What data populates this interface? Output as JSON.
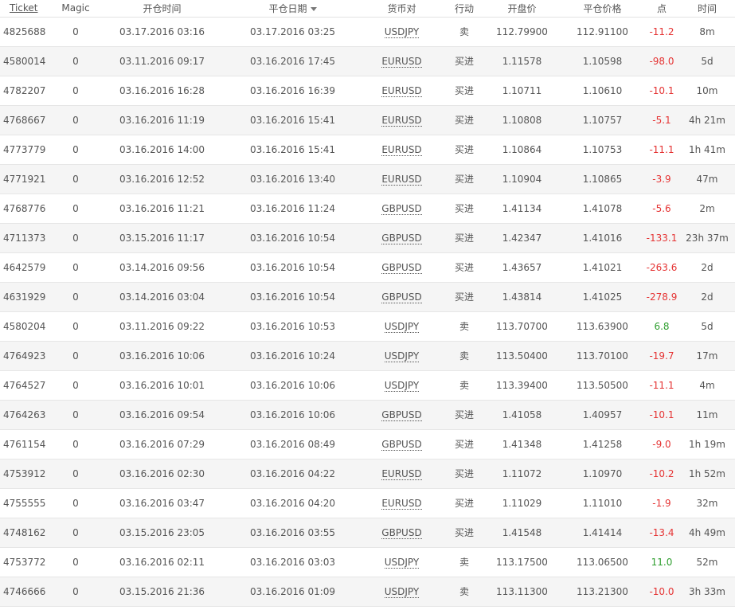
{
  "headers": {
    "ticket": "Ticket",
    "magic": "Magic",
    "open_time": "开仓时间",
    "close_date": "平仓日期",
    "symbol": "货币对",
    "action": "行动",
    "open_price": "开盘价",
    "close_price": "平仓价格",
    "points": "点",
    "duration": "时间"
  },
  "colors": {
    "negative": "#e53333",
    "positive": "#2e9e2e"
  },
  "rows": [
    {
      "ticket": "4825688",
      "magic": "0",
      "open": "03.17.2016 03:16",
      "close": "03.17.2016 03:25",
      "symbol": "USDJPY",
      "action": "卖",
      "open_price": "112.79900",
      "close_price": "112.91100",
      "points": "-11.2",
      "duration": "8m",
      "sign": "neg"
    },
    {
      "ticket": "4580014",
      "magic": "0",
      "open": "03.11.2016 09:17",
      "close": "03.16.2016 17:45",
      "symbol": "EURUSD",
      "action": "买进",
      "open_price": "1.11578",
      "close_price": "1.10598",
      "points": "-98.0",
      "duration": "5d",
      "sign": "neg"
    },
    {
      "ticket": "4782207",
      "magic": "0",
      "open": "03.16.2016 16:28",
      "close": "03.16.2016 16:39",
      "symbol": "EURUSD",
      "action": "买进",
      "open_price": "1.10711",
      "close_price": "1.10610",
      "points": "-10.1",
      "duration": "10m",
      "sign": "neg"
    },
    {
      "ticket": "4768667",
      "magic": "0",
      "open": "03.16.2016 11:19",
      "close": "03.16.2016 15:41",
      "symbol": "EURUSD",
      "action": "买进",
      "open_price": "1.10808",
      "close_price": "1.10757",
      "points": "-5.1",
      "duration": "4h 21m",
      "sign": "neg"
    },
    {
      "ticket": "4773779",
      "magic": "0",
      "open": "03.16.2016 14:00",
      "close": "03.16.2016 15:41",
      "symbol": "EURUSD",
      "action": "买进",
      "open_price": "1.10864",
      "close_price": "1.10753",
      "points": "-11.1",
      "duration": "1h 41m",
      "sign": "neg"
    },
    {
      "ticket": "4771921",
      "magic": "0",
      "open": "03.16.2016 12:52",
      "close": "03.16.2016 13:40",
      "symbol": "EURUSD",
      "action": "买进",
      "open_price": "1.10904",
      "close_price": "1.10865",
      "points": "-3.9",
      "duration": "47m",
      "sign": "neg"
    },
    {
      "ticket": "4768776",
      "magic": "0",
      "open": "03.16.2016 11:21",
      "close": "03.16.2016 11:24",
      "symbol": "GBPUSD",
      "action": "买进",
      "open_price": "1.41134",
      "close_price": "1.41078",
      "points": "-5.6",
      "duration": "2m",
      "sign": "neg"
    },
    {
      "ticket": "4711373",
      "magic": "0",
      "open": "03.15.2016 11:17",
      "close": "03.16.2016 10:54",
      "symbol": "GBPUSD",
      "action": "买进",
      "open_price": "1.42347",
      "close_price": "1.41016",
      "points": "-133.1",
      "duration": "23h 37m",
      "sign": "neg"
    },
    {
      "ticket": "4642579",
      "magic": "0",
      "open": "03.14.2016 09:56",
      "close": "03.16.2016 10:54",
      "symbol": "GBPUSD",
      "action": "买进",
      "open_price": "1.43657",
      "close_price": "1.41021",
      "points": "-263.6",
      "duration": "2d",
      "sign": "neg"
    },
    {
      "ticket": "4631929",
      "magic": "0",
      "open": "03.14.2016 03:04",
      "close": "03.16.2016 10:54",
      "symbol": "GBPUSD",
      "action": "买进",
      "open_price": "1.43814",
      "close_price": "1.41025",
      "points": "-278.9",
      "duration": "2d",
      "sign": "neg"
    },
    {
      "ticket": "4580204",
      "magic": "0",
      "open": "03.11.2016 09:22",
      "close": "03.16.2016 10:53",
      "symbol": "USDJPY",
      "action": "卖",
      "open_price": "113.70700",
      "close_price": "113.63900",
      "points": "6.8",
      "duration": "5d",
      "sign": "pos"
    },
    {
      "ticket": "4764923",
      "magic": "0",
      "open": "03.16.2016 10:06",
      "close": "03.16.2016 10:24",
      "symbol": "USDJPY",
      "action": "卖",
      "open_price": "113.50400",
      "close_price": "113.70100",
      "points": "-19.7",
      "duration": "17m",
      "sign": "neg"
    },
    {
      "ticket": "4764527",
      "magic": "0",
      "open": "03.16.2016 10:01",
      "close": "03.16.2016 10:06",
      "symbol": "USDJPY",
      "action": "卖",
      "open_price": "113.39400",
      "close_price": "113.50500",
      "points": "-11.1",
      "duration": "4m",
      "sign": "neg"
    },
    {
      "ticket": "4764263",
      "magic": "0",
      "open": "03.16.2016 09:54",
      "close": "03.16.2016 10:06",
      "symbol": "GBPUSD",
      "action": "买进",
      "open_price": "1.41058",
      "close_price": "1.40957",
      "points": "-10.1",
      "duration": "11m",
      "sign": "neg"
    },
    {
      "ticket": "4761154",
      "magic": "0",
      "open": "03.16.2016 07:29",
      "close": "03.16.2016 08:49",
      "symbol": "GBPUSD",
      "action": "买进",
      "open_price": "1.41348",
      "close_price": "1.41258",
      "points": "-9.0",
      "duration": "1h 19m",
      "sign": "neg"
    },
    {
      "ticket": "4753912",
      "magic": "0",
      "open": "03.16.2016 02:30",
      "close": "03.16.2016 04:22",
      "symbol": "EURUSD",
      "action": "买进",
      "open_price": "1.11072",
      "close_price": "1.10970",
      "points": "-10.2",
      "duration": "1h 52m",
      "sign": "neg"
    },
    {
      "ticket": "4755555",
      "magic": "0",
      "open": "03.16.2016 03:47",
      "close": "03.16.2016 04:20",
      "symbol": "EURUSD",
      "action": "买进",
      "open_price": "1.11029",
      "close_price": "1.11010",
      "points": "-1.9",
      "duration": "32m",
      "sign": "neg"
    },
    {
      "ticket": "4748162",
      "magic": "0",
      "open": "03.15.2016 23:05",
      "close": "03.16.2016 03:55",
      "symbol": "GBPUSD",
      "action": "买进",
      "open_price": "1.41548",
      "close_price": "1.41414",
      "points": "-13.4",
      "duration": "4h 49m",
      "sign": "neg"
    },
    {
      "ticket": "4753772",
      "magic": "0",
      "open": "03.16.2016 02:11",
      "close": "03.16.2016 03:03",
      "symbol": "USDJPY",
      "action": "卖",
      "open_price": "113.17500",
      "close_price": "113.06500",
      "points": "11.0",
      "duration": "52m",
      "sign": "pos"
    },
    {
      "ticket": "4746666",
      "magic": "0",
      "open": "03.15.2016 21:36",
      "close": "03.16.2016 01:09",
      "symbol": "USDJPY",
      "action": "卖",
      "open_price": "113.11300",
      "close_price": "113.21300",
      "points": "-10.0",
      "duration": "3h 33m",
      "sign": "neg"
    }
  ]
}
